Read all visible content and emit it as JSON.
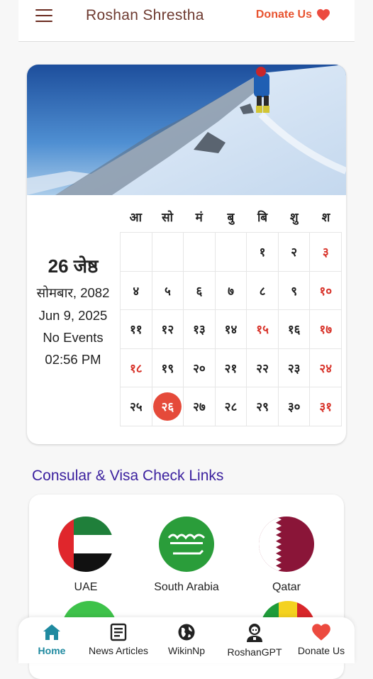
{
  "header": {
    "title": "Roshan Shrestha",
    "donate_label": "Donate Us"
  },
  "calendar": {
    "date_big": "26 जेष्ठ",
    "weekday_year": "सोमबार, 2082",
    "english_date": "Jun 9, 2025",
    "events": "No Events",
    "time": "02:56 PM",
    "weekdays": [
      "आ",
      "सो",
      "मं",
      "बु",
      "बि",
      "शु",
      "श"
    ],
    "weeks": [
      [
        "",
        "",
        "",
        "",
        "१",
        "२",
        "३"
      ],
      [
        "४",
        "५",
        "६",
        "७",
        "८",
        "९",
        "१०"
      ],
      [
        "११",
        "१२",
        "१३",
        "१४",
        "१५",
        "१६",
        "१७"
      ],
      [
        "१८",
        "१९",
        "२०",
        "२१",
        "२२",
        "२३",
        "२४"
      ],
      [
        "२५",
        "२६",
        "२७",
        "२८",
        "२९",
        "३०",
        "३१"
      ]
    ],
    "today": "२६",
    "holidays": [
      "१५",
      "१८"
    ]
  },
  "consular": {
    "title": "Consular & Visa Check Links",
    "countries": [
      {
        "name": "UAE",
        "icon": "uae-flag-icon"
      },
      {
        "name": "South Arabia",
        "icon": "saudi-flag-icon"
      },
      {
        "name": "Qatar",
        "icon": "qatar-flag-icon"
      }
    ]
  },
  "nav": {
    "items": [
      {
        "label": "Home",
        "icon": "home-icon"
      },
      {
        "label": "News Articles",
        "icon": "news-icon"
      },
      {
        "label": "WikinNp",
        "icon": "globe-icon"
      },
      {
        "label": "RoshanGPT",
        "icon": "bot-icon"
      },
      {
        "label": "Donate Us",
        "icon": "heart-icon"
      }
    ]
  },
  "colors": {
    "accent_red": "#e54a3a",
    "brand_brown": "#6e3a30",
    "section_purple": "#3a1f9e",
    "nav_active": "#1f8aa0"
  }
}
